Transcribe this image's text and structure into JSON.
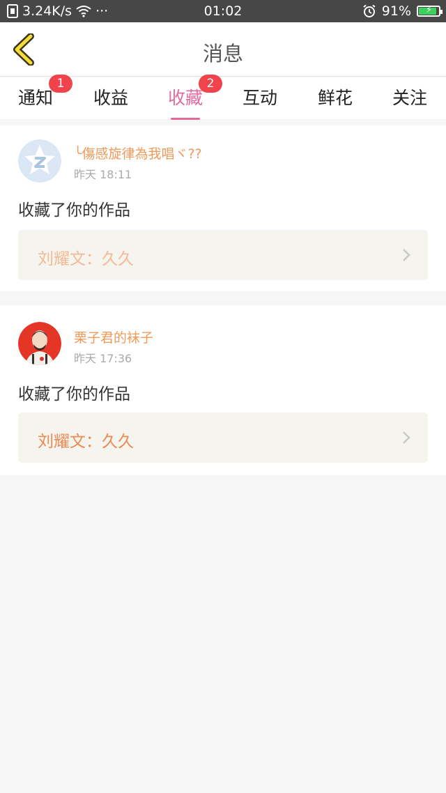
{
  "status_bar": {
    "network_speed": "3.24K/s",
    "more": "···",
    "time": "01:02",
    "battery": "91%",
    "battery_level": 0.91
  },
  "header": {
    "title": "消息"
  },
  "tabs": [
    {
      "label": "通知",
      "badge": "1"
    },
    {
      "label": "收益"
    },
    {
      "label": "收藏",
      "badge": "2",
      "active": true
    },
    {
      "label": "互动"
    },
    {
      "label": "鲜花"
    },
    {
      "label": "关注"
    }
  ],
  "messages": [
    {
      "username": "╰傷感旋律為我唱ヾ??",
      "time": "昨天 18:11",
      "action": "收藏了你的作品",
      "work": "刘耀文：久久",
      "work_color": "#f4ba95",
      "avatar": "default-avatar-icon"
    },
    {
      "username": "栗子君的袜子",
      "time": "昨天 17:36",
      "action": "收藏了你的作品",
      "work": "刘耀文：久久",
      "work_color": "#ec8a54",
      "avatar": "user-photo-avatar"
    }
  ],
  "colors": {
    "accent_pink": "#e46aa0",
    "badge_red": "#f0434b",
    "username_orange": "#f09a5a",
    "back_yellow": "#f5dc3a"
  }
}
